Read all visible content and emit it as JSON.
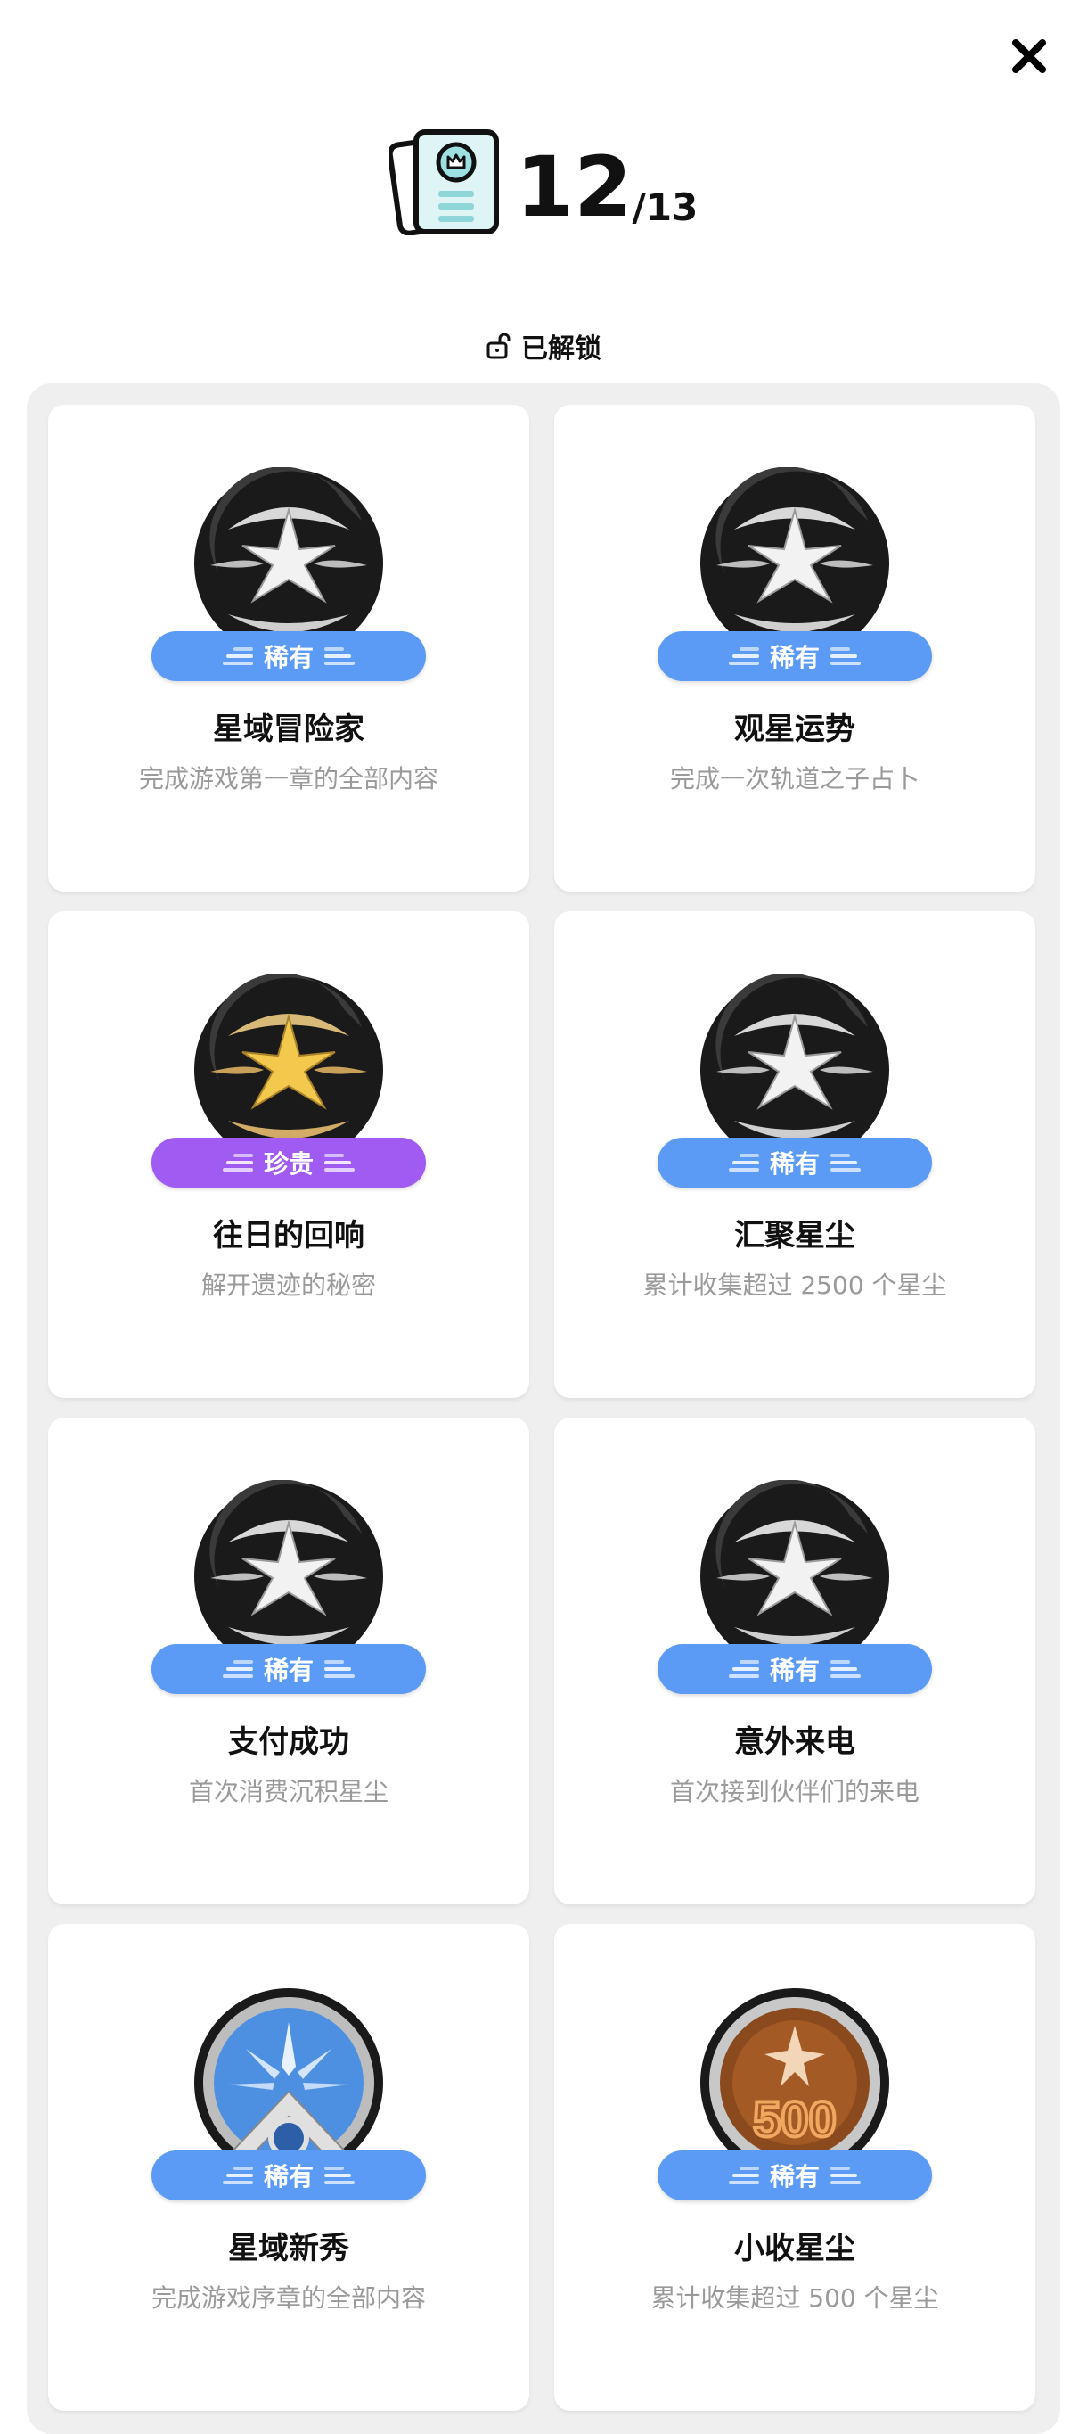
{
  "header": {
    "unlocked_count": "12",
    "total_count": "/13",
    "unlocked_label": "已解锁"
  },
  "colors": {
    "rare": "#5b9bf5",
    "precious": "#a05bf3",
    "panel_bg": "#efefef"
  },
  "achievements": [
    {
      "title": "星域冒险家",
      "desc": "完成游戏第一章的全部内容",
      "rarity": "稀有",
      "medal": "silver-star-medal"
    },
    {
      "title": "观星运势",
      "desc": "完成一次轨道之子占卜",
      "rarity": "稀有",
      "medal": "silver-star-medal"
    },
    {
      "title": "往日的回响",
      "desc": "解开遗迹的秘密",
      "rarity": "珍贵",
      "medal": "gold-star-medal"
    },
    {
      "title": "汇聚星尘",
      "desc": "累计收集超过 2500 个星尘",
      "rarity": "稀有",
      "medal": "silver-star-medal"
    },
    {
      "title": "支付成功",
      "desc": "首次消费沉积星尘",
      "rarity": "稀有",
      "medal": "silver-star-medal"
    },
    {
      "title": "意外来电",
      "desc": "首次接到伙伴们的来电",
      "rarity": "稀有",
      "medal": "silver-star-medal"
    },
    {
      "title": "星域新秀",
      "desc": "完成游戏序章的全部内容",
      "rarity": "稀有",
      "medal": "blue-rookie-medal"
    },
    {
      "title": "小收星尘",
      "desc": "累计收集超过 500 个星尘",
      "rarity": "稀有",
      "medal": "bronze-500-medal",
      "medal_text": "500"
    }
  ]
}
